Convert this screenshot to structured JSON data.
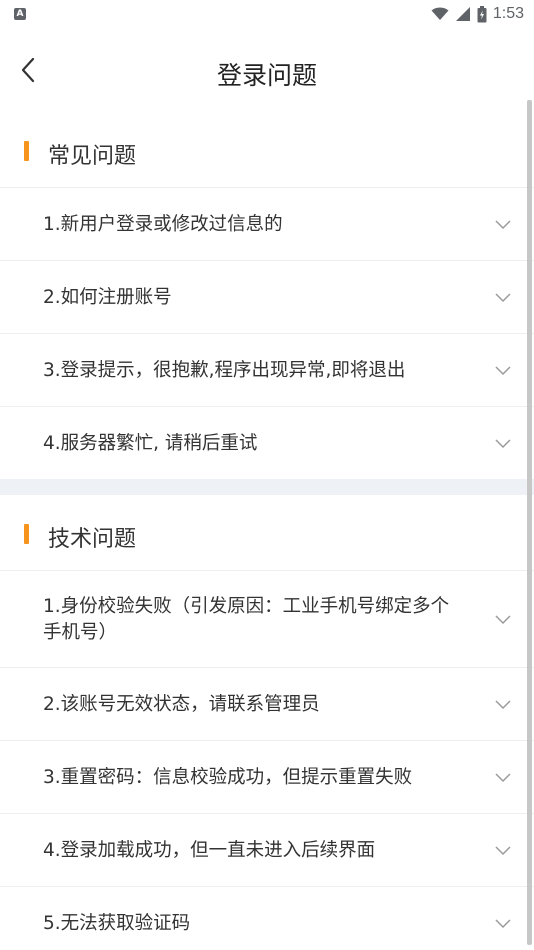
{
  "status_bar": {
    "left_icon_glyph": "A",
    "time": "1:53",
    "icons": [
      "wifi-icon",
      "signal-icon",
      "battery-icon"
    ]
  },
  "nav": {
    "title": "登录问题",
    "back_icon": "chevron-left-icon"
  },
  "sections": [
    {
      "title": "常见问题",
      "items": [
        {
          "text": "1.新用户登录或修改过信息的"
        },
        {
          "text": "2.如何注册账号"
        },
        {
          "text": "3.登录提示，很抱歉,程序出现异常,即将退出"
        },
        {
          "text": "4.服务器繁忙, 请稍后重试"
        }
      ]
    },
    {
      "title": "技术问题",
      "items": [
        {
          "text": "1.身份校验失败（引发原因：工业手机号绑定多个手机号）"
        },
        {
          "text": "2.该账号无效状态，请联系管理员"
        },
        {
          "text": "3.重置密码：信息校验成功，但提示重置失败"
        },
        {
          "text": "4.登录加载成功，但一直未进入后续界面"
        },
        {
          "text": "5.无法获取验证码"
        }
      ]
    }
  ],
  "colors": {
    "accent": "#f7941d",
    "divider": "#eeeeee",
    "gap": "#eef2f7"
  }
}
